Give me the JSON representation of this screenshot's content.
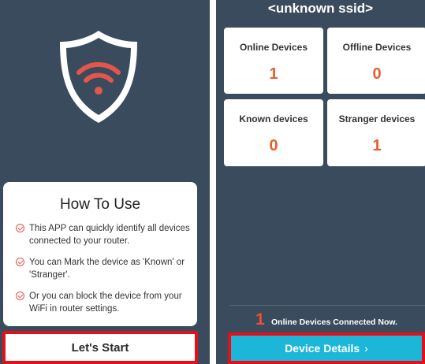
{
  "left": {
    "howto": {
      "title": "How To Use",
      "items": [
        "This APP can quickly identify all devices connected to your router.",
        "You can Mark the device as 'Known' or 'Stranger'.",
        "Or you can block the device from your WiFi in router settings."
      ]
    },
    "start_button": "Let's Start",
    "logo_icon": "shield-wifi-icon"
  },
  "right": {
    "ssid": "<unknown ssid>",
    "stats": [
      {
        "label": "Online Devices",
        "value": "1"
      },
      {
        "label": "Offline Devices",
        "value": "0"
      },
      {
        "label": "Known devices",
        "value": "0"
      },
      {
        "label": "Stranger devices",
        "value": "1"
      }
    ],
    "connected_count": "1",
    "connected_text": "Online Devices Connected Now.",
    "details_button": "Device Details",
    "details_chevron": "›"
  },
  "colors": {
    "background": "#3b4b5e",
    "accent": "#e65f2a",
    "button": "#1bb6d8",
    "highlight": "#e3101a"
  }
}
